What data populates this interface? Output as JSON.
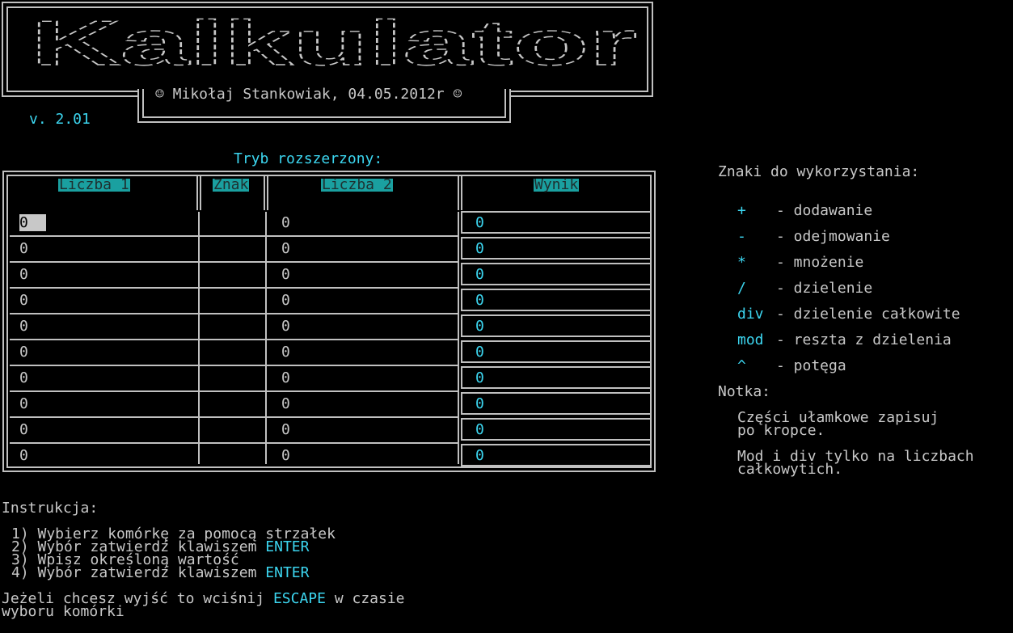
{
  "header": {
    "title": "Kalkulator",
    "subtitle": "☺ Mikołaj Stankowiak, 04.05.2012r ☺",
    "version": "v. 2.01"
  },
  "table": {
    "mode_label": "Tryb rozszerzony:",
    "columns": [
      "Liczba 1",
      "Znak",
      "Liczba 2",
      "Wynik"
    ],
    "rows": [
      {
        "a": "0",
        "op": "",
        "b": "0",
        "result": "0"
      },
      {
        "a": "0",
        "op": "",
        "b": "0",
        "result": "0"
      },
      {
        "a": "0",
        "op": "",
        "b": "0",
        "result": "0"
      },
      {
        "a": "0",
        "op": "",
        "b": "0",
        "result": "0"
      },
      {
        "a": "0",
        "op": "",
        "b": "0",
        "result": "0"
      },
      {
        "a": "0",
        "op": "",
        "b": "0",
        "result": "0"
      },
      {
        "a": "0",
        "op": "",
        "b": "0",
        "result": "0"
      },
      {
        "a": "0",
        "op": "",
        "b": "0",
        "result": "0"
      },
      {
        "a": "0",
        "op": "",
        "b": "0",
        "result": "0"
      },
      {
        "a": "0",
        "op": "",
        "b": "0",
        "result": "0"
      }
    ]
  },
  "legend": {
    "title": "Znaki do wykorzystania:",
    "items": [
      {
        "symbol": "+",
        "desc": "- dodawanie"
      },
      {
        "symbol": "-",
        "desc": "- odejmowanie"
      },
      {
        "symbol": "*",
        "desc": "- mnożenie"
      },
      {
        "symbol": "/",
        "desc": "- dzielenie"
      },
      {
        "symbol": "div",
        "desc": "- dzielenie całkowite"
      },
      {
        "symbol": "mod",
        "desc": "- reszta z dzielenia"
      },
      {
        "symbol": "^",
        "desc": "- potęga"
      }
    ],
    "note_title": "Notka:",
    "notes": [
      {
        "line1": "Części ułamkowe zapisuj",
        "line2": "po kropce."
      },
      {
        "line1": "Mod i div tylko na liczbach",
        "line2": "całkowytich."
      }
    ]
  },
  "instructions": {
    "title": "Instrukcja:",
    "steps": [
      {
        "text": "1) Wybierz komórkę za pomocą strzałek",
        "key": ""
      },
      {
        "text": "2) Wybór zatwierdź klawiszem ",
        "key": "ENTER"
      },
      {
        "text": "3) Wpisz określoną wartość",
        "key": ""
      },
      {
        "text": "4) Wybór zatwierdź klawiszem ",
        "key": "ENTER"
      }
    ],
    "escape_prefix": "Jeżeli chcesz wyjść to wciśnij ",
    "escape_key": "ESCAPE",
    "escape_suffix": " w czasie",
    "escape_line2": "wyboru komórki"
  },
  "colors": {
    "accent": "#3cd6f0",
    "header_bg": "#1aa0a0",
    "text": "#c8c8c8",
    "background": "#000000"
  }
}
